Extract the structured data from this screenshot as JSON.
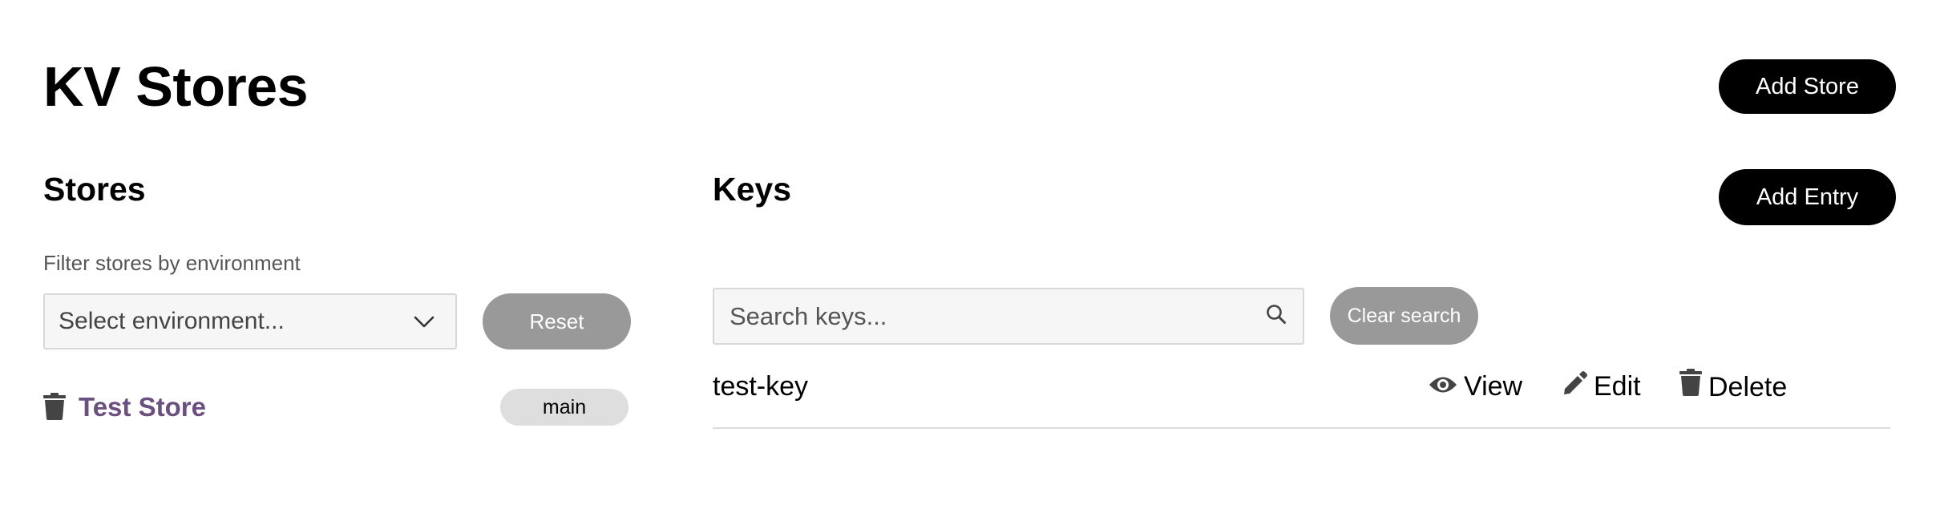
{
  "header": {
    "title": "KV Stores",
    "add_store_label": "Add Store"
  },
  "stores": {
    "title": "Stores",
    "filter_label": "Filter stores by environment",
    "select_placeholder": "Select environment...",
    "reset_label": "Reset",
    "items": [
      {
        "name": "Test Store",
        "environment": "main",
        "icon": "trash-icon"
      }
    ]
  },
  "keys": {
    "title": "Keys",
    "add_entry_label": "Add Entry",
    "search_placeholder": "Search keys...",
    "search_icon": "search-icon",
    "clear_search_label": "Clear search",
    "rows": [
      {
        "key": "test-key",
        "actions": [
          {
            "label": "View",
            "icon": "eye-icon"
          },
          {
            "label": "Edit",
            "icon": "pencil-icon"
          },
          {
            "label": "Delete",
            "icon": "trash-icon"
          }
        ]
      }
    ]
  },
  "colors": {
    "primary_button": "#000000",
    "secondary_button": "#999999",
    "store_link": "#6b4f7f",
    "badge_bg": "#dedede"
  }
}
